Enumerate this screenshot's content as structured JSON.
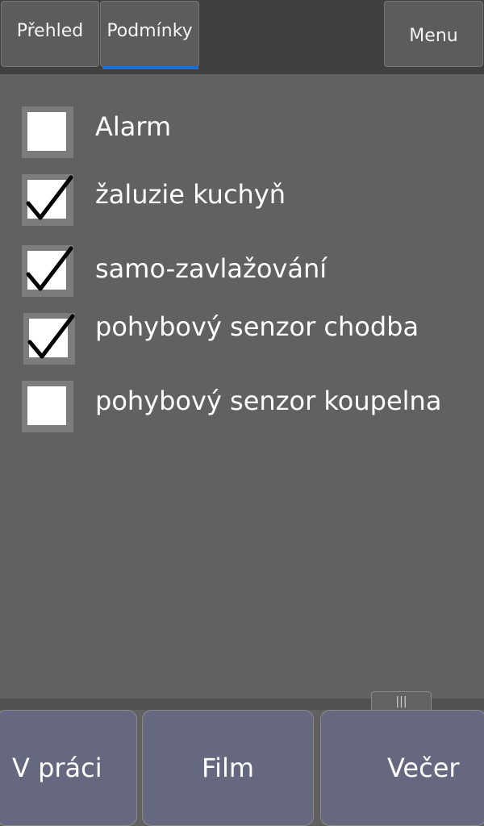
{
  "header": {
    "tabs": [
      {
        "label": "Přehled",
        "active": false
      },
      {
        "label": "Podmínky",
        "active": true
      }
    ],
    "menu_label": "Menu",
    "accent_color": "#1a6fd8"
  },
  "conditions": [
    {
      "label": "Alarm",
      "checked": false
    },
    {
      "label": "žaluzie kuchyň",
      "checked": true
    },
    {
      "label": "samo-zavlažování",
      "checked": true
    },
    {
      "label": "pohybový senzor chodba",
      "checked": true
    },
    {
      "label": "pohybový senzor koupelna",
      "checked": false
    }
  ],
  "footer": {
    "grip_icon": "drag-handle-icon",
    "scenes": [
      {
        "label": "V práci"
      },
      {
        "label": "Film"
      },
      {
        "label": "Večer"
      }
    ]
  }
}
